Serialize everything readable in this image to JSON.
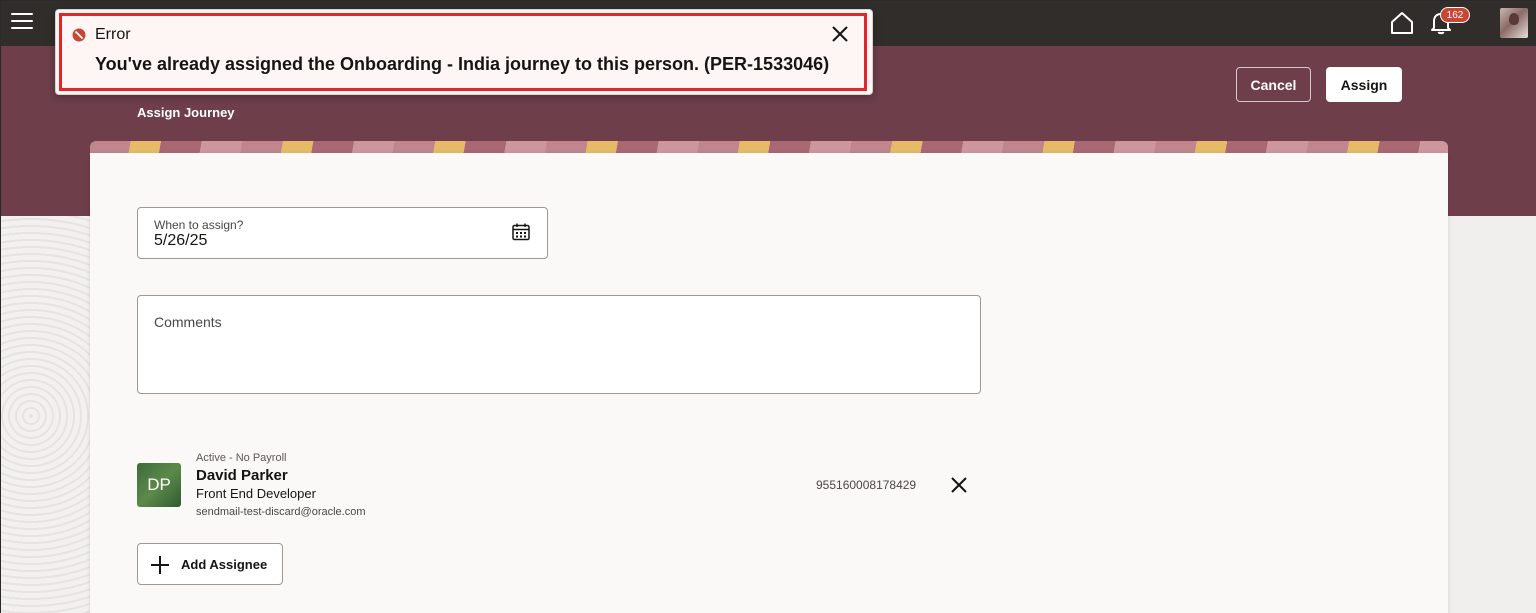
{
  "header": {
    "subtitle": "Assign Journey",
    "cancel_label": "Cancel",
    "assign_label": "Assign"
  },
  "topbar": {
    "notifications_count": "162"
  },
  "toast": {
    "title": "Error",
    "message": "You've already assigned the Onboarding - India journey to this person. (PER-1533046)"
  },
  "form": {
    "when_label": "When to assign?",
    "when_value": "5/26/25",
    "comments_label": "Comments"
  },
  "assignee": {
    "initials": "DP",
    "status": "Active - No Payroll",
    "name": "David Parker",
    "job_title": "Front End Developer",
    "email": "sendmail-test-discard@oracle.com",
    "person_id": "955160008178429"
  },
  "actions": {
    "add_assignee_label": "Add Assignee"
  },
  "colors": {
    "topbar": "#312d2a",
    "header_band": "#6e3e4b",
    "error_red": "#e0252b",
    "badge": "#c74634"
  }
}
